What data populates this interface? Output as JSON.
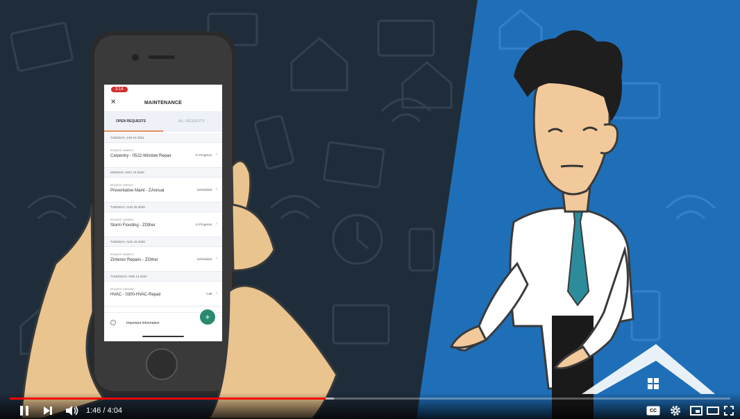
{
  "video": {
    "progress_fraction": 0.4382,
    "buffered_fraction": 0.45
  },
  "phone": {
    "status_time": "3:14",
    "title": "MAINTENANCE",
    "tabs": [
      {
        "label": "OPEN REQUESTS"
      },
      {
        "label": "ALL REQUESTS"
      }
    ],
    "groups": [
      {
        "date": "TUESDAY, JAN 19 2021",
        "items": [
          {
            "request": "REQUEST #4681012",
            "name": "Carpentry - 0522-Window Repair",
            "status": "In Progress"
          }
        ]
      },
      {
        "date": "MONDAY, NOV 23 2020",
        "items": [
          {
            "request": "REQUEST #4640197",
            "name": "Preventative Maint - ZAnnual",
            "status": "Scheduled"
          }
        ]
      },
      {
        "date": "TUESDAY, AUG 25 2020",
        "items": [
          {
            "request": "REQUEST #4606840",
            "name": "Storm Flooding - ZOther",
            "status": "In Progress"
          }
        ]
      },
      {
        "date": "TUESDAY, AUG 18 2020",
        "items": [
          {
            "request": "REQUEST #4598178",
            "name": "ZInterior Repairs - ZOther",
            "status": "Scheduled"
          }
        ]
      },
      {
        "date": "THURSDAY, FEB 13 2020",
        "items": [
          {
            "request": "REQUEST #4501289",
            "name": "HVAC - 0300-HVAC-Repair",
            "status": "Call"
          }
        ]
      }
    ],
    "info_label": "Important Information",
    "fab_label": "+"
  },
  "controls": {
    "current_time": "1:46",
    "separator": " / ",
    "duration": "4:04",
    "cc_label": "CC"
  },
  "colors": {
    "background": "#1f2d3b",
    "blue_panel": "#1f6fb8",
    "progress_played": "#ff0000",
    "fab": "#2b8a6e"
  }
}
